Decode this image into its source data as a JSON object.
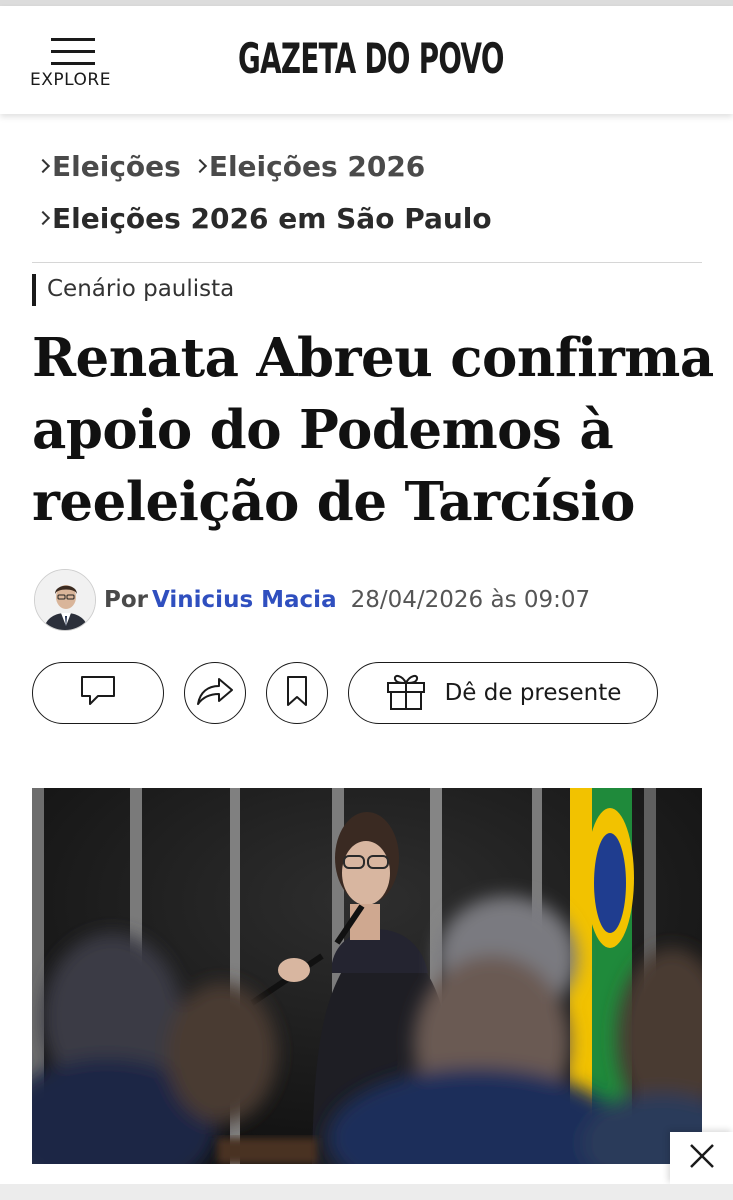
{
  "header": {
    "menu_label": "EXPLORE",
    "logo_text": "GAZETA DO POVO"
  },
  "breadcrumb": {
    "items": [
      {
        "label": "Eleições"
      },
      {
        "label": "Eleições 2026"
      },
      {
        "label": "Eleições 2026 em São Paulo"
      }
    ]
  },
  "article": {
    "kicker": "Cenário paulista",
    "headline_lines": [
      "Renata Abreu confirma",
      "apoio do Podemos à",
      "reeleição de Tarcísio"
    ],
    "byline_prefix": "Por",
    "author": "Vinicius Macia",
    "date": "28/04/2026 às 09:07"
  },
  "actions": {
    "gift_label": "Dê de presente",
    "icons": [
      "comment-icon",
      "share-icon",
      "bookmark-icon",
      "gift-icon"
    ]
  },
  "colors": {
    "author_link": "#2f4fbf",
    "text": "#1a1a1a",
    "flag_green": "#1f8a3b",
    "flag_yellow": "#f2c200",
    "flag_blue": "#1f3d8f"
  }
}
